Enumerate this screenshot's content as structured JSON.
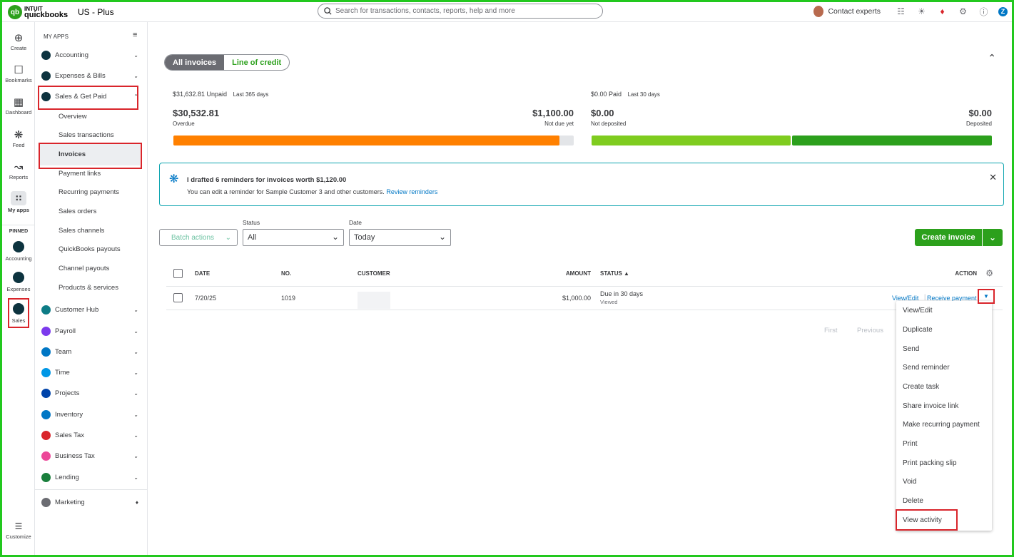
{
  "topbar": {
    "logo_small": "INTUIT",
    "logo_big": "quickbooks",
    "logo_badge": "qb",
    "company": "US - Plus",
    "search_placeholder": "Search for transactions, contacts, reports, help and more",
    "contact_experts": "Contact experts",
    "user_initial": "Z",
    "icons": [
      "clipboard-icon",
      "lightbulb-icon",
      "bell-icon",
      "gear-icon",
      "help-icon"
    ]
  },
  "rail": {
    "items": [
      {
        "label": "Create",
        "icon": "plus-circle-icon"
      },
      {
        "label": "Bookmarks",
        "icon": "bookmark-icon"
      },
      {
        "label": "Dashboard",
        "icon": "dashboard-icon"
      },
      {
        "label": "Feed",
        "icon": "sparkle-icon"
      },
      {
        "label": "Reports",
        "icon": "chart-line-icon"
      },
      {
        "label": "My apps",
        "icon": "grid-icon"
      }
    ],
    "pinned_label": "PINNED",
    "pinned": [
      {
        "label": "Accounting",
        "color": "#0d333f"
      },
      {
        "label": "Expenses",
        "color": "#0d333f"
      },
      {
        "label": "Sales",
        "color": "#0d333f"
      }
    ],
    "customize": "Customize"
  },
  "nav": {
    "header": "MY APPS",
    "items": [
      {
        "label": "Accounting",
        "color": "#0e7c86"
      },
      {
        "label": "Expenses & Bills",
        "color": "#1a7f3c"
      },
      {
        "label": "Sales & Get Paid",
        "color": "#2ca01c"
      }
    ],
    "sales_sub": [
      "Overview",
      "Sales transactions",
      "Invoices",
      "Payment links",
      "Recurring payments",
      "Sales orders",
      "Sales channels",
      "QuickBooks payouts",
      "Channel payouts",
      "Products & services"
    ],
    "items2": [
      {
        "label": "Customer Hub",
        "color": "#0e7c86"
      },
      {
        "label": "Payroll",
        "color": "#7c3aed"
      },
      {
        "label": "Team",
        "color": "#0077c5"
      },
      {
        "label": "Time",
        "color": "#0097e6"
      },
      {
        "label": "Projects",
        "color": "#0044aa"
      },
      {
        "label": "Inventory",
        "color": "#0077c5"
      },
      {
        "label": "Sales Tax",
        "color": "#d9252b"
      },
      {
        "label": "Business Tax",
        "color": "#ec4899"
      },
      {
        "label": "Lending",
        "color": "#1a7f3c"
      }
    ],
    "marketing": "Marketing"
  },
  "main": {
    "tabs": [
      "All invoices",
      "Line of credit"
    ],
    "unpaid": {
      "amount": "$31,632.81 Unpaid",
      "period": "Last 365 days",
      "overdue_amount": "$30,532.81",
      "overdue_label": "Overdue",
      "notdue_amount": "$1,100.00",
      "notdue_label": "Not due yet",
      "overdue_fraction": 0.965
    },
    "paid": {
      "amount": "$0.00 Paid",
      "period": "Last 30 days",
      "notdeposited_amount": "$0.00",
      "notdeposited_label": "Not deposited",
      "deposited_amount": "$0.00",
      "deposited_label": "Deposited"
    },
    "banner": {
      "title": "I drafted 6 reminders for invoices worth $1,120.00",
      "text": "You can edit a reminder for Sample Customer 3 and other customers.",
      "link": "Review reminders"
    },
    "filters": {
      "batch": "Batch actions",
      "status_label": "Status",
      "status_value": "All",
      "date_label": "Date",
      "date_value": "Today"
    },
    "create_invoice": "Create invoice",
    "table": {
      "headers": [
        "DATE",
        "NO.",
        "CUSTOMER",
        "AMOUNT",
        "STATUS ▲",
        "ACTION"
      ],
      "rows": [
        {
          "date": "7/20/25",
          "no": "1019",
          "customer": "",
          "amount": "$1,000.00",
          "status": "Due in 30 days",
          "substatus": "Viewed",
          "action1": "View/Edit",
          "action2": "Receive payment"
        }
      ]
    },
    "pager": [
      "First",
      "Previous"
    ],
    "menu": [
      "View/Edit",
      "Duplicate",
      "Send",
      "Send reminder",
      "Create task",
      "Share invoice link",
      "Make recurring payment",
      "Print",
      "Print packing slip",
      "Void",
      "Delete",
      "View activity"
    ]
  }
}
